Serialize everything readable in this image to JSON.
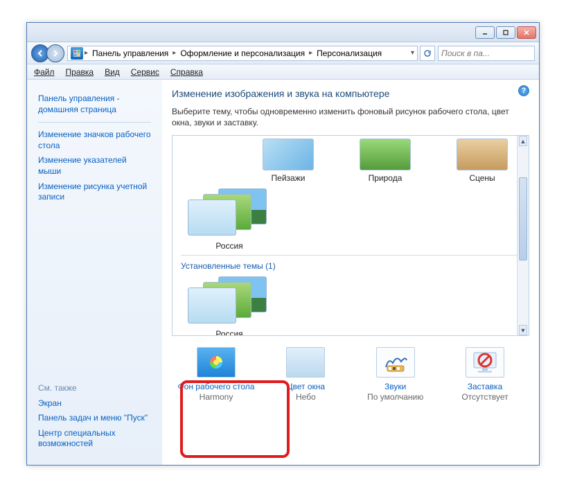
{
  "breadcrumb": {
    "seg1": "Панель управления",
    "seg2": "Оформление и персонализация",
    "seg3": "Персонализация"
  },
  "search": {
    "placeholder": "Поиск в па..."
  },
  "menu": {
    "file": "Файл",
    "edit": "Правка",
    "view": "Вид",
    "tools": "Сервис",
    "help": "Справка"
  },
  "sidebar": {
    "home": "Панель управления - домашняя страница",
    "link1": "Изменение значков рабочего стола",
    "link2": "Изменение указателей мыши",
    "link3": "Изменение рисунка учетной записи",
    "see_also_label": "См. также",
    "see1": "Экран",
    "see2": "Панель задач и меню \"Пуск\"",
    "see3": "Центр специальных возможностей"
  },
  "content": {
    "heading": "Изменение изображения и звука на компьютере",
    "subtitle": "Выберите тему, чтобы одновременно изменить фоновый рисунок рабочего стола, цвет окна, звуки и заставку."
  },
  "themes": {
    "top": [
      {
        "label": "Пейзажи"
      },
      {
        "label": "Природа"
      },
      {
        "label": "Сцены"
      }
    ],
    "stack1_label": "Россия",
    "section_label": "Установленные темы (1)",
    "stack2_label": "Россия"
  },
  "settings": {
    "bg": {
      "title": "Фон рабочего стола",
      "value": "Harmony"
    },
    "color": {
      "title": "Цвет окна",
      "value": "Небо"
    },
    "sound": {
      "title": "Звуки",
      "value": "По умолчанию"
    },
    "saver": {
      "title": "Заставка",
      "value": "Отсутствует"
    }
  }
}
